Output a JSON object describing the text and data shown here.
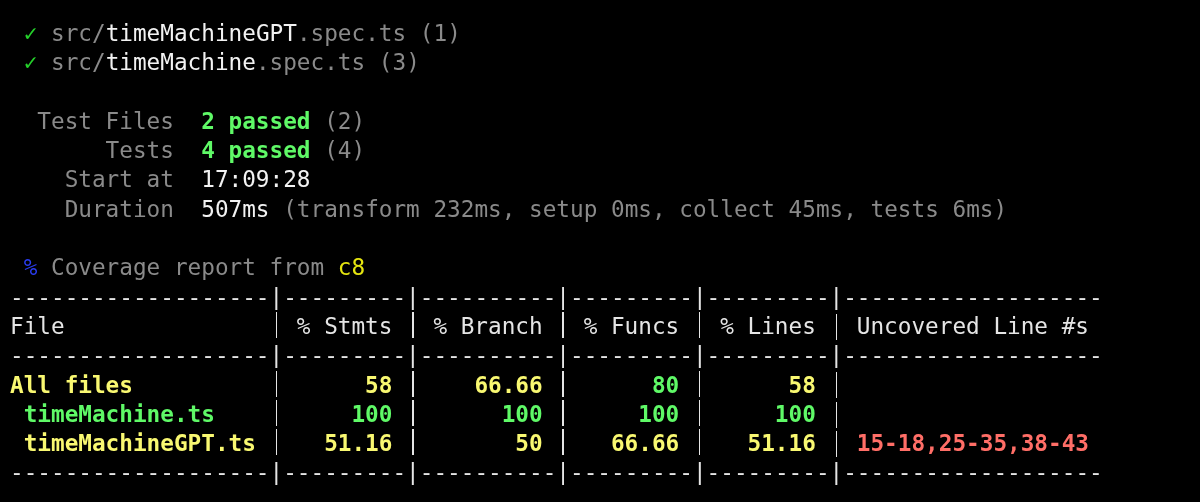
{
  "spec_files": [
    {
      "mark": "✓",
      "dir": "src/",
      "name": "timeMachineGPT",
      "ext": ".spec.ts",
      "count": "(1)"
    },
    {
      "mark": "✓",
      "dir": "src/",
      "name": "timeMachine",
      "ext": ".spec.ts",
      "count": "(3)"
    }
  ],
  "summary": [
    {
      "label": "Test Files",
      "kind": "passed",
      "value": "2 passed",
      "detail": "(2)"
    },
    {
      "label": "Tests",
      "kind": "passed",
      "value": "4 passed",
      "detail": "(4)"
    },
    {
      "label": "Start at",
      "kind": "plain",
      "value": "17:09:28"
    },
    {
      "label": "Duration",
      "kind": "plain",
      "value": "507ms",
      "detail": "(transform 232ms, setup 0ms, collect 45ms, tests 6ms)"
    }
  ],
  "coverage": {
    "mark": "%",
    "text": "Coverage report from",
    "tool": "c8"
  },
  "table": {
    "rules": [
      "-------------------|---------|----------|---------|---------|-------------------",
      "-------------------|---------|----------|---------|---------|-------------------",
      "-------------------|---------|----------|---------|---------|-------------------"
    ],
    "columns": [
      "File",
      "% Stmts",
      "% Branch",
      "% Funcs",
      "% Lines",
      "Uncovered Line #s"
    ],
    "rows": [
      {
        "cells": [
          {
            "text": "All files",
            "color": "#f9f871"
          },
          {
            "text": "58",
            "color": "#f9f871"
          },
          {
            "text": "66.66",
            "color": "#f9f871"
          },
          {
            "text": "80",
            "color": "#5ff967"
          },
          {
            "text": "58",
            "color": "#f9f871"
          }
        ],
        "children": [
          {
            "cells": [
              {
                "text": "timeMachine.ts",
                "color": "#5ff967"
              },
              {
                "text": "100",
                "color": "#5ff967"
              },
              {
                "text": "100",
                "color": "#5ff967"
              },
              {
                "text": "100",
                "color": "#5ff967"
              },
              {
                "text": "100",
                "color": "#5ff967"
              }
            ]
          },
          {
            "cells": [
              {
                "text": "timeMachineGPT.ts",
                "color": "#f9f871"
              },
              {
                "text": "51.16",
                "color": "#f9f871"
              },
              {
                "text": "50",
                "color": "#f9f871"
              },
              {
                "text": "66.66",
                "color": "#f9f871"
              },
              {
                "text": "51.16",
                "color": "#f9f871"
              },
              {
                "text": "15-18,25-35,38-43",
                "color": "#ff6e67"
              }
            ]
          }
        ]
      }
    ]
  }
}
